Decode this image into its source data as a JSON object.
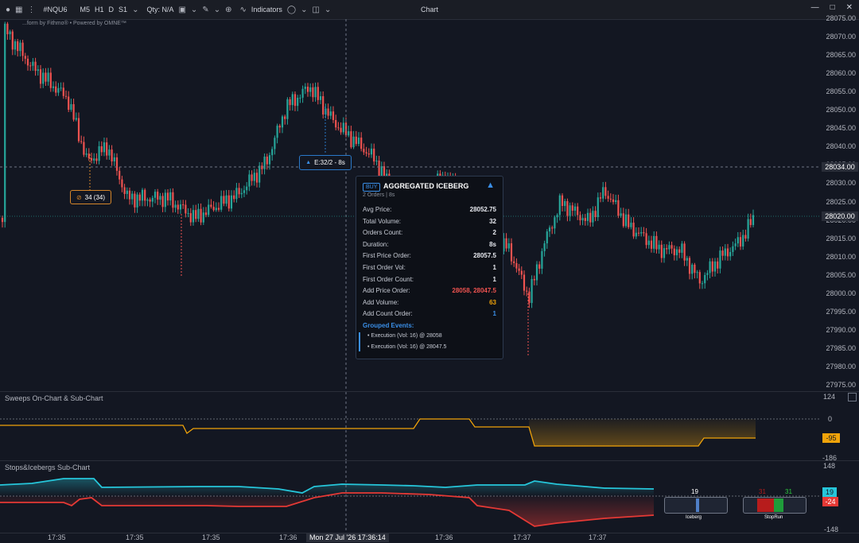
{
  "toolbar": {
    "symbol": "#NQU6",
    "timeframes": [
      "M5",
      "H1",
      "D",
      "S1"
    ],
    "qty_label": "Qty: N/A",
    "indicators_label": "Indicators",
    "window_title": "Chart"
  },
  "main_pane": {
    "watermark": "...form by Fithmo® • Powered by OMNE™",
    "price_ticks": [
      "28075.00",
      "28070.00",
      "28065.00",
      "28060.00",
      "28055.00",
      "28050.00",
      "28045.00",
      "28040.00",
      "28035.00",
      "28030.00",
      "28025.00",
      "28020.00",
      "28015.00",
      "28010.00",
      "28005.00",
      "28000.00",
      "27995.00",
      "27990.00",
      "27985.00",
      "27980.00",
      "27975.00"
    ],
    "crosshair_price": "28034.00",
    "last_price": "28020.00",
    "iceberg_marker": "34 (34)",
    "exec_marker": "E:32/2 - 8s",
    "colors": {
      "up": "#26a69a",
      "down": "#ef5350",
      "bg": "#131722"
    }
  },
  "tooltip": {
    "side": "BUY",
    "title": "AGGREGATED ICEBERG",
    "subtitle": "2 Orders | 8s",
    "rows": [
      {
        "label": "Avg Price:",
        "value": "28052.75"
      },
      {
        "label": "Total Volume:",
        "value": "32"
      },
      {
        "label": "Orders Count:",
        "value": "2"
      },
      {
        "label": "Duration:",
        "value": "8s"
      },
      {
        "label": "First Price Order:",
        "value": "28057.5"
      },
      {
        "label": "First Order Vol:",
        "value": "1"
      },
      {
        "label": "First Order Count:",
        "value": "1"
      },
      {
        "label": "Add Price Order:",
        "value": "28058, 28047.5"
      },
      {
        "label": "Add Volume:",
        "value": "63"
      },
      {
        "label": "Add Count Order:",
        "value": "1"
      }
    ],
    "group_title": "Grouped Events:",
    "events": [
      "• Execution (Vol: 16) @ 28058",
      "• Execution (Vol: 16) @ 28047.5"
    ]
  },
  "sweeps_pane": {
    "title": "Sweeps On-Chart & Sub-Chart",
    "ticks": [
      "124",
      "0",
      "-186"
    ],
    "value_tag": "-95"
  },
  "stops_pane": {
    "title": "Stops&Icebergs Sub-Chart",
    "ticks": [
      "148",
      "-148"
    ],
    "value_up": "19",
    "value_down": "-24",
    "iceberg_count": "19",
    "iceberg_label": "Iceberg",
    "stoprun_left": "31",
    "stoprun_right": "31",
    "stoprun_label": "StopRun"
  },
  "time_axis": {
    "labels": [
      "17:35",
      "17:35",
      "17:35",
      "17:36",
      "17:36",
      "17:36",
      "17:37",
      "17:37"
    ],
    "crosshair_time": "Mon 27 Jul '26 17:36:14"
  }
}
